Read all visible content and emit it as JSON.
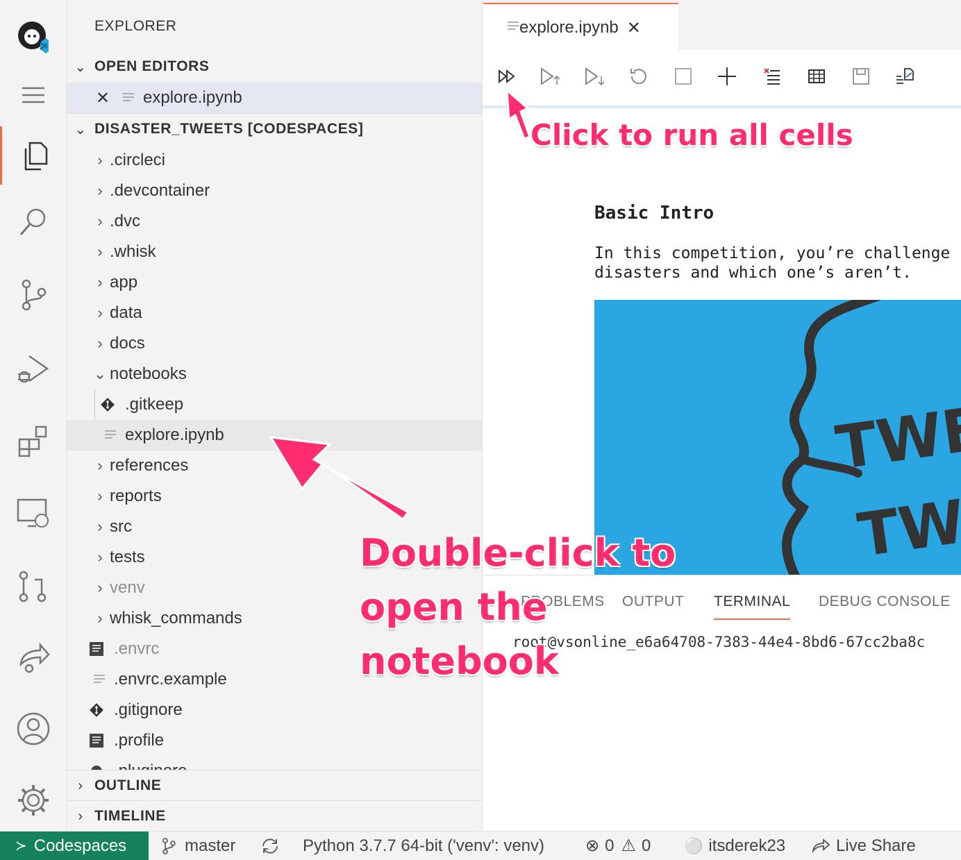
{
  "sidebar": {
    "title": "EXPLORER",
    "open_editors": {
      "label": "OPEN EDITORS",
      "items": [
        {
          "name": "explore.ipynb"
        }
      ]
    },
    "workspace": {
      "label": "DISASTER_TWEETS [CODESPACES]",
      "items": [
        {
          "name": ".circleci"
        },
        {
          "name": ".devcontainer"
        },
        {
          "name": ".dvc"
        },
        {
          "name": ".whisk"
        },
        {
          "name": "app"
        },
        {
          "name": "data"
        },
        {
          "name": "docs"
        },
        {
          "name": "notebooks"
        },
        {
          "name": ".gitkeep"
        },
        {
          "name": "explore.ipynb"
        },
        {
          "name": "references"
        },
        {
          "name": "reports"
        },
        {
          "name": "src"
        },
        {
          "name": "tests"
        },
        {
          "name": "venv"
        },
        {
          "name": "whisk_commands"
        },
        {
          "name": ".envrc"
        },
        {
          "name": ".envrc.example"
        },
        {
          "name": ".gitignore"
        },
        {
          "name": ".profile"
        },
        {
          "name": ".pluginore"
        }
      ]
    },
    "outline_label": "OUTLINE",
    "timeline_label": "TIMELINE"
  },
  "editor": {
    "tab_label": "explore.ipynb",
    "notebook": {
      "heading": "Basic Intro",
      "para_line1": "In this competition, you’re challenge",
      "para_line2": "disasters and which one’s aren’t.",
      "image_text1": "TWE",
      "image_text2": "TW"
    }
  },
  "panel": {
    "tabs": [
      "PROBLEMS",
      "OUTPUT",
      "TERMINAL",
      "DEBUG CONSOLE"
    ],
    "active_tab": "TERMINAL",
    "terminal_line": "root@vsonline_e6a64708-7383-44e4-8bd6-67cc2ba8c"
  },
  "status": {
    "remote": "Codespaces",
    "branch": "master",
    "python": "Python 3.7.7 64-bit ('venv': venv)",
    "errors": "0",
    "warnings": "0",
    "user": "itsderek23",
    "live_share": "Live Share"
  },
  "annotations": {
    "run_all": "Click to run all cells",
    "open_line1": "Double-click to",
    "open_line2": "open the",
    "open_line3": "notebook"
  },
  "colors": {
    "accent": "#f26b47",
    "annotation": "#ff2d6f",
    "remote_bg": "#16825d",
    "image_bg": "#2aa7e2"
  }
}
